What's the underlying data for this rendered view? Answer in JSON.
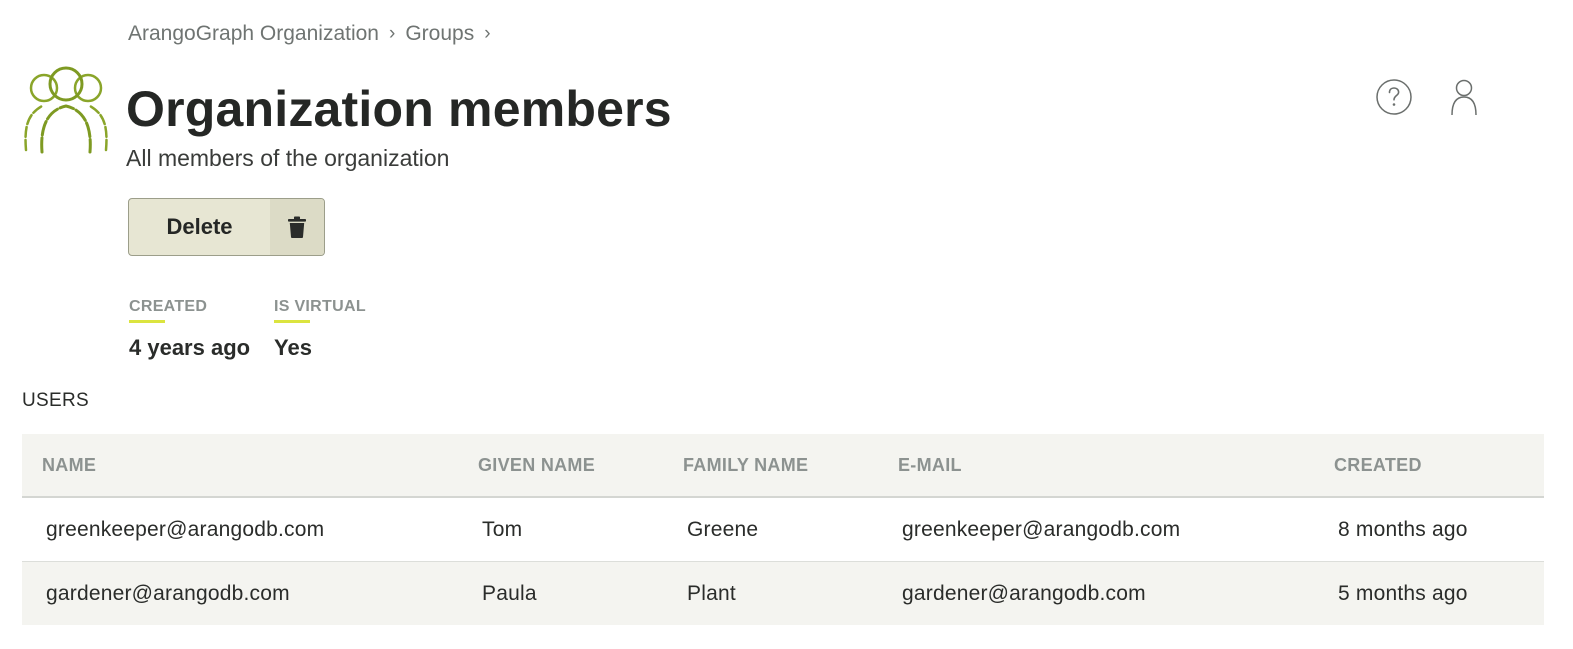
{
  "breadcrumb": {
    "items": [
      "ArangoGraph Organization",
      "Groups"
    ],
    "separator": "›"
  },
  "header": {
    "title": "Organization members",
    "subtitle": "All members of the organization",
    "icon": "users-group-icon"
  },
  "toolbar": {
    "delete_label": "Delete",
    "delete_icon": "trash-icon"
  },
  "top_icons": [
    "help-icon",
    "user-icon"
  ],
  "meta": [
    {
      "label": "CREATED",
      "value": "4 years ago"
    },
    {
      "label": "IS VIRTUAL",
      "value": "Yes"
    }
  ],
  "users": {
    "title": "USERS",
    "columns": [
      "NAME",
      "GIVEN NAME",
      "FAMILY NAME",
      "E-MAIL",
      "CREATED"
    ],
    "rows": [
      [
        "greenkeeper@arangodb.com",
        "Tom",
        "Greene",
        "greenkeeper@arangodb.com",
        "8 months ago"
      ],
      [
        "gardener@arangodb.com",
        "Paula",
        "Plant",
        "gardener@arangodb.com",
        "5 months ago"
      ]
    ]
  },
  "colors": {
    "accent": "#dbe43f",
    "icon_green": "#8aa52a",
    "button_bg": "#e7e6d3",
    "header_bg": "#f4f4f0"
  }
}
